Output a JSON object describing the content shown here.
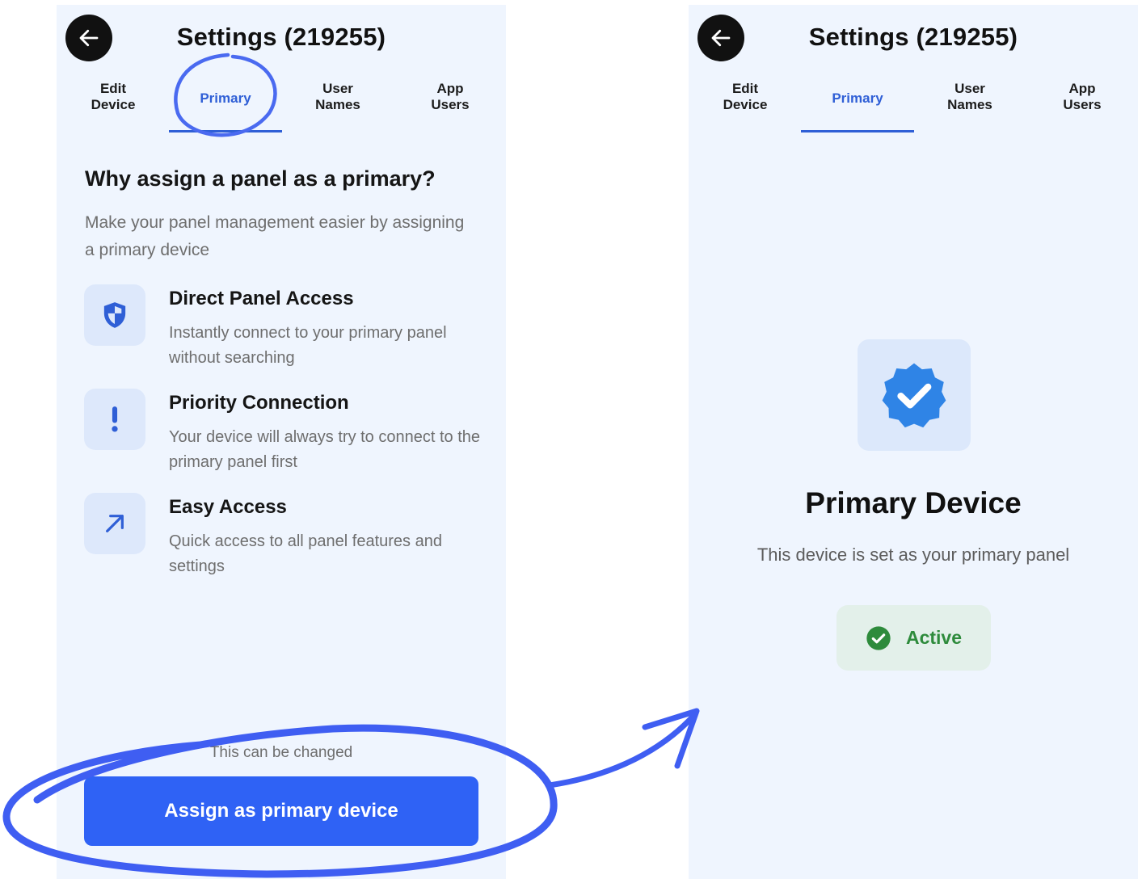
{
  "left_screen": {
    "title": "Settings (219255)",
    "tabs": [
      {
        "line1": "Edit",
        "line2": "Device"
      },
      {
        "line1": "Primary",
        "line2": ""
      },
      {
        "line1": "User",
        "line2": "Names"
      },
      {
        "line1": "App",
        "line2": "Users"
      }
    ],
    "active_tab": "Primary",
    "heading": "Why assign a panel as a primary?",
    "subheading": "Make your panel management easier by assigning a primary device",
    "features": [
      {
        "icon": "shield-icon",
        "title": "Direct Panel Access",
        "description": "Instantly connect to your primary panel without searching"
      },
      {
        "icon": "exclamation-icon",
        "title": "Priority Connection",
        "description": "Your device will always try to connect to the primary panel first"
      },
      {
        "icon": "arrow-up-right-icon",
        "title": "Easy Access",
        "description": "Quick access to all panel features and settings"
      }
    ],
    "note": "This can be changed",
    "button_label": "Assign as primary device"
  },
  "right_screen": {
    "title": "Settings (219255)",
    "tabs": [
      {
        "line1": "Edit",
        "line2": "Device"
      },
      {
        "line1": "Primary",
        "line2": ""
      },
      {
        "line1": "User",
        "line2": "Names"
      },
      {
        "line1": "App",
        "line2": "Users"
      }
    ],
    "active_tab": "Primary",
    "badge_icon": "verified-badge-icon",
    "heading": "Primary Device",
    "subheading": "This device is set as your primary panel",
    "status_icon": "check-circle-icon",
    "status_label": "Active"
  },
  "colors": {
    "screen_background": "#eff5fe",
    "accent_blue": "#2f5fd6",
    "button_blue": "#2f62f5",
    "badge_blue": "#2f84e6",
    "success_green": "#2e8b3c",
    "annotation_stroke": "#4a6af0"
  }
}
